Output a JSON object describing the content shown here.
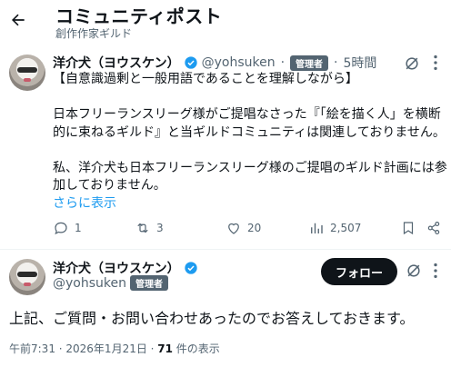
{
  "header": {
    "title": "コミュニティポスト",
    "subtitle": "創作作家ギルド"
  },
  "post": {
    "author_name": "洋介犬（ヨウスケン）",
    "handle": "@yohsuken",
    "separator": "·",
    "role_badge": "管理者",
    "time": "5時間",
    "lines": [
      "【自意識過剰と一般用語であることを理解しながら】",
      "",
      "日本フリーランスリーグ様がご提唱なさった『「絵を描く人」を横断",
      "的に束ねるギルド』と当ギルドコミュニティは関連しておりません。",
      "",
      "私、洋介犬も日本フリーランスリーグ様のご提唱のギルド計画には参",
      "加しておりません。"
    ],
    "show_more": "さらに表示",
    "stats": {
      "replies": "1",
      "reposts": "3",
      "likes": "20",
      "views": "2,507"
    }
  },
  "detail": {
    "author_name": "洋介犬（ヨウスケン）",
    "handle": "@yohsuken",
    "role_badge": "管理者",
    "follow_label": "フォロー",
    "text": "上記、ご質問・お問い合わせあったのでお答えしておきます。",
    "timestamp": "午前7:31 · 2026年1月21日 · ",
    "view_count": "71",
    "view_suffix": " 件の表示"
  },
  "colors": {
    "text": "#0f1419",
    "muted": "#536471",
    "link": "#1d9bf0",
    "verified": "#1d9bf0",
    "button": "#0f1419"
  },
  "icons": [
    "back-arrow-icon",
    "verified-icon",
    "mute-icon",
    "more-icon",
    "reply-icon",
    "repost-icon",
    "like-icon",
    "views-icon",
    "bookmark-icon",
    "share-icon"
  ]
}
